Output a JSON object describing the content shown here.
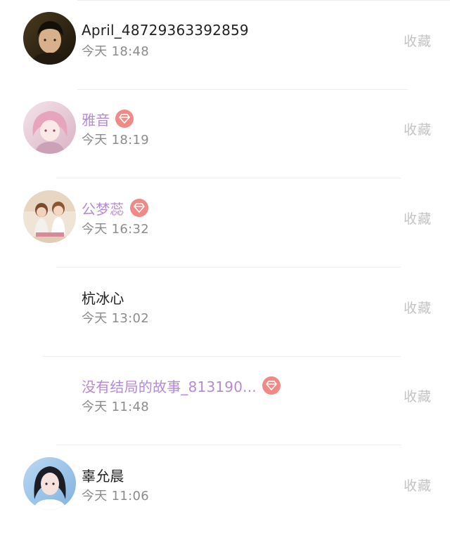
{
  "collect_label": "收藏",
  "colors": {
    "name_default": "#222222",
    "name_vip": "#b78ad8",
    "time": "#8c8c8c",
    "collect": "#c4c4c4",
    "vip_badge": "#ef8a86",
    "divider": "#eeeeee"
  },
  "entries": [
    {
      "name": "April_48729363392859",
      "time": "今天 18:48",
      "vip": false,
      "has_avatar": true
    },
    {
      "name": "雅音",
      "time": "今天 18:19",
      "vip": true,
      "has_avatar": true
    },
    {
      "name": "公梦蕊",
      "time": "今天 16:32",
      "vip": true,
      "has_avatar": true
    },
    {
      "name": "杭冰心",
      "time": "今天 13:02",
      "vip": false,
      "has_avatar": false
    },
    {
      "name": "没有结局的故事_813190...",
      "time": "今天 11:48",
      "vip": true,
      "has_avatar": false
    },
    {
      "name": "辜允晨",
      "time": "今天 11:06",
      "vip": false,
      "has_avatar": true
    }
  ]
}
